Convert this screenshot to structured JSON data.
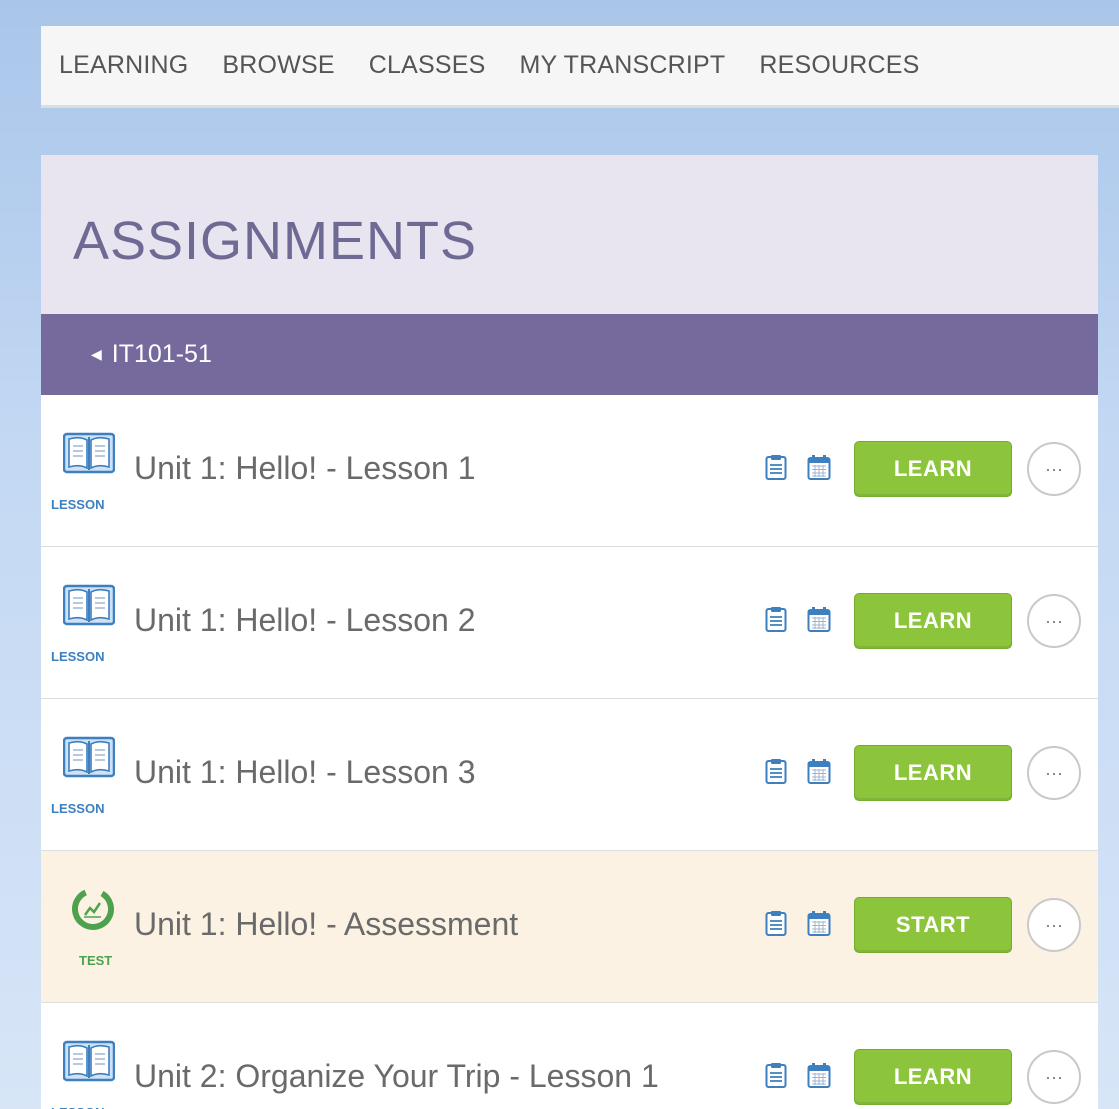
{
  "nav": {
    "items": [
      "LEARNING",
      "BROWSE",
      "CLASSES",
      "MY TRANSCRIPT",
      "RESOURCES"
    ]
  },
  "panel": {
    "title": "ASSIGNMENTS",
    "class_name": "IT101-51"
  },
  "rows": [
    {
      "type": "LESSON",
      "icon": "book-icon",
      "title": "Unit 1: Hello! - Lesson 1",
      "action": "LEARN"
    },
    {
      "type": "LESSON",
      "icon": "book-icon",
      "title": "Unit 1: Hello! - Lesson 2",
      "action": "LEARN"
    },
    {
      "type": "LESSON",
      "icon": "book-icon",
      "title": "Unit 1: Hello! - Lesson 3",
      "action": "LEARN"
    },
    {
      "type": "TEST",
      "icon": "progress-chart-icon",
      "title": "Unit 1: Hello! - Assessment",
      "action": "START",
      "highlight": true
    },
    {
      "type": "LESSON",
      "icon": "book-icon",
      "title": "Unit 2: Organize Your Trip - Lesson 1",
      "action": "LEARN"
    }
  ],
  "colors": {
    "accent_purple": "#766a9c",
    "button_green": "#8cc43c",
    "highlight_row": "#fbf2e3",
    "lesson_blue": "#3d7fbf",
    "test_green": "#4ea24e"
  }
}
